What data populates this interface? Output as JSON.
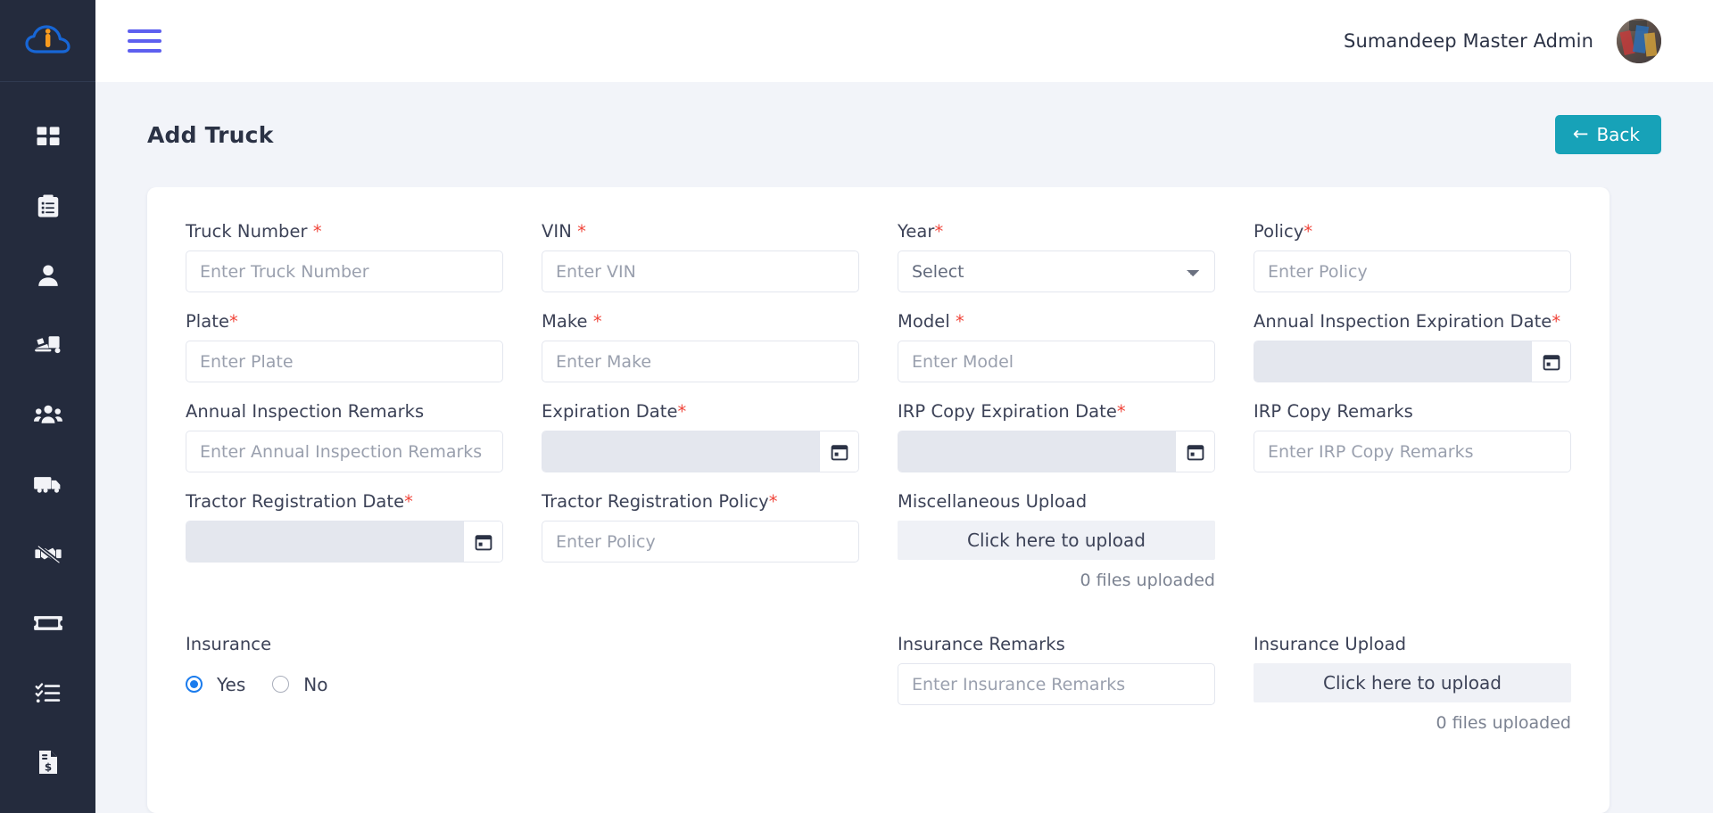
{
  "sidebar": {
    "logo_name": "cloud-info-logo",
    "items": [
      {
        "name": "dashboard",
        "icon": "grid-icon"
      },
      {
        "name": "orders",
        "icon": "clipboard-list-icon"
      },
      {
        "name": "customers",
        "icon": "user-icon"
      },
      {
        "name": "shipments",
        "icon": "loading-truck-icon"
      },
      {
        "name": "teams",
        "icon": "users-group-icon"
      },
      {
        "name": "trucks",
        "icon": "truck-icon"
      },
      {
        "name": "no-deal",
        "icon": "handshake-slash-icon"
      },
      {
        "name": "cards",
        "icon": "ticket-icon"
      },
      {
        "name": "tasks",
        "icon": "checklist-icon"
      },
      {
        "name": "invoices",
        "icon": "invoice-dollar-icon"
      }
    ]
  },
  "topbar": {
    "menu_icon": "hamburger-icon",
    "user_name": "Sumandeep Master Admin",
    "avatar_name": "user-avatar"
  },
  "page": {
    "title": "Add Truck",
    "back_label": "Back",
    "back_arrow": "←",
    "back_color": "#17a2b8"
  },
  "form": {
    "rows": [
      [
        {
          "label": "Truck Number ",
          "required": true,
          "type": "text",
          "placeholder": "Enter Truck Number",
          "value": "",
          "name": "truck-number"
        },
        {
          "label": "VIN ",
          "required": true,
          "type": "text",
          "placeholder": "Enter VIN",
          "value": "",
          "name": "vin"
        },
        {
          "label": "Year",
          "required": true,
          "type": "select",
          "selected": "Select",
          "options": [
            "Select"
          ],
          "name": "year"
        },
        {
          "label": "Policy",
          "required": true,
          "type": "text",
          "placeholder": "Enter Policy",
          "value": "",
          "name": "policy"
        }
      ],
      [
        {
          "label": "Plate",
          "required": true,
          "type": "text",
          "placeholder": "Enter Plate",
          "value": "",
          "name": "plate"
        },
        {
          "label": "Make ",
          "required": true,
          "type": "text",
          "placeholder": "Enter Make",
          "value": "",
          "name": "make"
        },
        {
          "label": "Model ",
          "required": true,
          "type": "text",
          "placeholder": "Enter Model",
          "value": "",
          "name": "model"
        },
        {
          "label": "Annual Inspection Expiration Date",
          "required": true,
          "type": "date",
          "placeholder": "",
          "value": "",
          "name": "annual-inspection-expiration-date"
        }
      ],
      [
        {
          "label": "Annual Inspection Remarks",
          "required": false,
          "type": "text",
          "placeholder": "Enter Annual Inspection Remarks",
          "value": "",
          "name": "annual-inspection-remarks"
        },
        {
          "label": "Expiration Date",
          "required": true,
          "type": "date",
          "placeholder": "",
          "value": "",
          "name": "expiration-date"
        },
        {
          "label": "IRP Copy Expiration Date",
          "required": true,
          "type": "date",
          "placeholder": "",
          "value": "",
          "name": "irp-copy-expiration-date"
        },
        {
          "label": "IRP Copy Remarks",
          "required": false,
          "type": "text",
          "placeholder": "Enter IRP Copy Remarks",
          "value": "",
          "name": "irp-copy-remarks"
        }
      ],
      [
        {
          "label": "Tractor Registration Date",
          "required": true,
          "type": "date",
          "placeholder": "",
          "value": "",
          "name": "tractor-registration-date"
        },
        {
          "label": "Tractor Registration Policy",
          "required": true,
          "type": "text",
          "placeholder": "Enter Policy",
          "value": "",
          "name": "tractor-registration-policy"
        },
        {
          "label": "Miscellaneous Upload",
          "required": false,
          "type": "upload",
          "upload_label": "Click here to upload",
          "files_note": "0 files uploaded",
          "name": "miscellaneous-upload"
        }
      ]
    ],
    "insurance": {
      "label": "Insurance",
      "options": [
        {
          "label": "Yes",
          "checked": true
        },
        {
          "label": "No",
          "checked": false
        }
      ],
      "remarks_label": "Insurance Remarks",
      "remarks_placeholder": "Enter Insurance Remarks",
      "remarks_value": "",
      "upload_label": "Insurance Upload",
      "upload_button": "Click here to upload",
      "files_note": "0 files uploaded"
    },
    "required_marker": "*",
    "calendar_icon": "calendar-icon"
  }
}
